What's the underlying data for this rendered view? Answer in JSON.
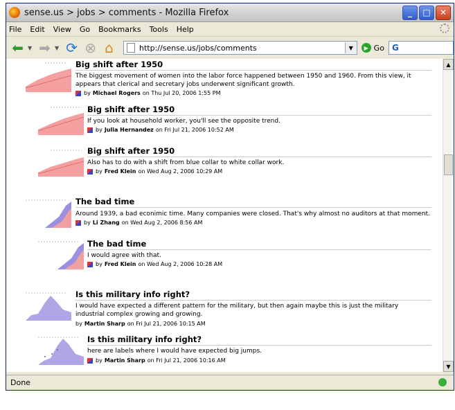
{
  "window": {
    "title": "sense.us > jobs > comments - Mozilla Firefox"
  },
  "menu": [
    "File",
    "Edit",
    "View",
    "Go",
    "Bookmarks",
    "Tools",
    "Help"
  ],
  "nav": {
    "url": "http://sense.us/jobs/comments",
    "go_label": "Go"
  },
  "status": {
    "text": "Done"
  },
  "comments": [
    {
      "title": "Big shift after 1950",
      "body": "The biggest movement of women into the labor force happened between 1950 and 1960. From this view, it appears that clerical and secretary jobs underwent significant growth.",
      "by": "by",
      "author": "Michael Rogers",
      "date": "on Thu Jul 20, 2006 1:55 PM",
      "thumb": "red-area"
    },
    {
      "title": "Big shift after 1950",
      "body": "If you look at household worker, you'll see the opposite trend.",
      "by": "by",
      "author": "Julia Hernandez",
      "date": "on Fri Jul 21, 2006 10:52 AM",
      "thumb": "red-area"
    },
    {
      "title": "Big shift after 1950",
      "body": "Also has to do with a shift from blue collar to white collar work.",
      "by": "by",
      "author": "Fred Klein",
      "date": "on Wed Aug 2, 2006 10:29 AM",
      "thumb": "red-area"
    },
    {
      "title": "The bad time",
      "body": "Around 1939, a bad econimic time. Many companies were closed. That's why almost no auditors at that moment.",
      "by": "by",
      "author": "Li Zhang",
      "date": "on Wed Aug 2, 2006 8:56 AM",
      "thumb": "blue-red-area"
    },
    {
      "title": "The bad time",
      "body": "I would agree with that.",
      "by": "by",
      "author": "Fred Klein",
      "date": "on Wed Aug 2, 2006 10:28 AM",
      "thumb": "blue-red-area"
    },
    {
      "title": "Is this military info right?",
      "body": "I would have expected a different pattern for the military, but then again maybe this is just the military industrial complex growing and growing.",
      "by": "by",
      "author": "Martin Sharp",
      "date": "on Fri Jul 21, 2006 10:15 AM",
      "thumb": "purple-area"
    },
    {
      "title": "Is this military info right?",
      "body": "here are labels where I would have expected big jumps.",
      "by": "by",
      "author": "Martin Sharp",
      "date": "on Fri Jul 21, 2006 10:16 AM",
      "thumb": "purple-area"
    }
  ]
}
